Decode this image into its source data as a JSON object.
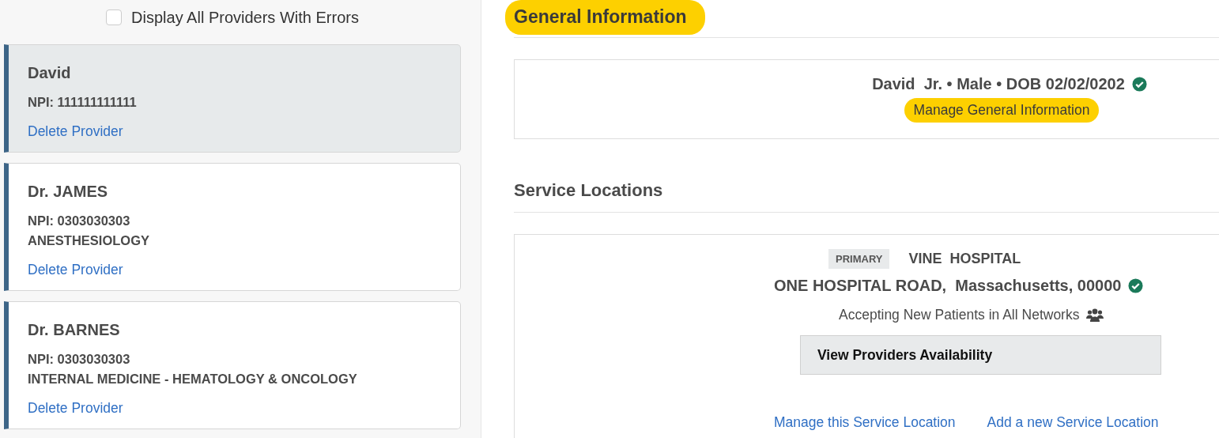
{
  "sidebar": {
    "filter": {
      "label": "Display All Providers With Errors",
      "checked": false
    },
    "providers": [
      {
        "name": "David",
        "npi": "NPI: 111111111111",
        "action": "Delete Provider",
        "selected": true
      },
      {
        "name": "Dr. JAMES",
        "npi": "NPI: 0303030303",
        "specialty": "ANESTHESIOLOGY",
        "action": "Delete Provider",
        "selected": false
      },
      {
        "name": "Dr. BARNES",
        "npi": "NPI: 0303030303",
        "specialty": "INTERNAL MEDICINE - HEMATOLOGY & ONCOLOGY",
        "action": "Delete Provider",
        "selected": false
      }
    ]
  },
  "general_information": {
    "heading": "General Information",
    "heading_highlighted": true,
    "summary": "David  Jr. • Male • DOB 02/02/0202",
    "verified": true,
    "manage_button": {
      "label": "Manage General Information",
      "highlighted": true
    }
  },
  "service_locations": {
    "heading": "Service Locations",
    "location": {
      "badge": "PRIMARY",
      "name": "VINE  HOSPITAL",
      "address": "ONE HOSPITAL ROAD,  Massachusetts, 00000",
      "verified": true,
      "accepting": "Accepting New Patients in All Networks",
      "availability_button": "View Providers Availability",
      "links": [
        "Manage this Service Location",
        "Add a new Service Location"
      ]
    }
  }
}
